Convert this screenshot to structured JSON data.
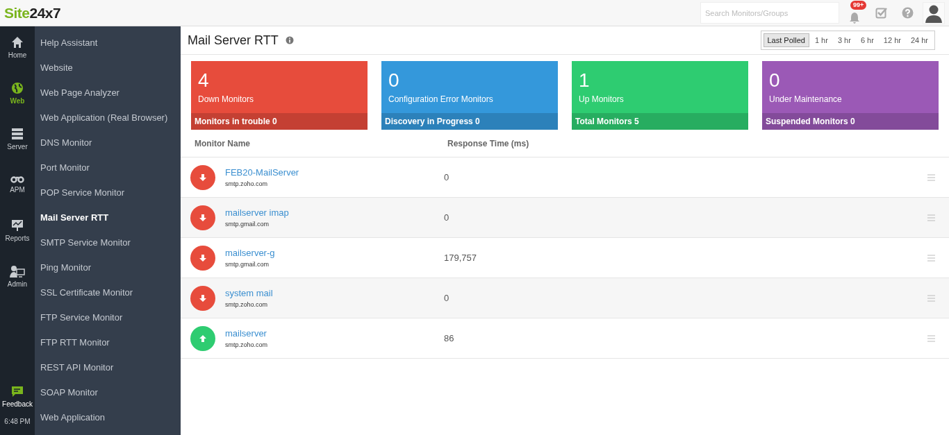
{
  "header": {
    "logo_part_1": "Site",
    "logo_part_2": "24x7",
    "search": {
      "placeholder": "Search Monitors/Groups"
    },
    "notification_badge": "99+"
  },
  "rail": {
    "items": [
      {
        "label": "Home",
        "kind": "home",
        "selected": false
      },
      {
        "label": "Web",
        "kind": "globe",
        "selected": true
      },
      {
        "label": "Server",
        "kind": "server",
        "selected": false
      },
      {
        "label": "APM",
        "kind": "binoculars",
        "selected": false
      },
      {
        "label": "Reports",
        "kind": "chart",
        "selected": false
      },
      {
        "label": "Admin",
        "kind": "admin",
        "selected": false
      }
    ],
    "feedback": "Feedback",
    "time": "6:48 PM"
  },
  "submenu": {
    "items": [
      {
        "label": "Help Assistant",
        "selected": false
      },
      {
        "label": "Website",
        "selected": false
      },
      {
        "label": "Web Page Analyzer",
        "selected": false
      },
      {
        "label": "Web Application (Real Browser)",
        "selected": false
      },
      {
        "label": "DNS Monitor",
        "selected": false
      },
      {
        "label": "Port Monitor",
        "selected": false
      },
      {
        "label": "POP Service Monitor",
        "selected": false
      },
      {
        "label": "Mail Server RTT",
        "selected": true
      },
      {
        "label": "SMTP Service Monitor",
        "selected": false
      },
      {
        "label": "Ping Monitor",
        "selected": false
      },
      {
        "label": "SSL Certificate Monitor",
        "selected": false
      },
      {
        "label": "FTP Service Monitor",
        "selected": false
      },
      {
        "label": "FTP RTT Monitor",
        "selected": false
      },
      {
        "label": "REST API Monitor",
        "selected": false
      },
      {
        "label": "SOAP Monitor",
        "selected": false
      },
      {
        "label": "Web Application",
        "selected": false
      }
    ]
  },
  "page": {
    "title": "Mail Server RTT",
    "periods": [
      {
        "label": "Last Polled",
        "selected": true
      },
      {
        "label": "1 hr",
        "selected": false
      },
      {
        "label": "3 hr",
        "selected": false
      },
      {
        "label": "6 hr",
        "selected": false
      },
      {
        "label": "12 hr",
        "selected": false
      },
      {
        "label": "24 hr",
        "selected": false
      }
    ],
    "cards": [
      {
        "count": "4",
        "label": "Down Monitors",
        "footer": "Monitors in trouble 0",
        "color": "#e74c3c"
      },
      {
        "count": "0",
        "label": "Configuration Error Monitors",
        "footer": "Discovery in Progress 0",
        "color": "#3498db"
      },
      {
        "count": "1",
        "label": "Up Monitors",
        "footer": "Total Monitors 5",
        "color": "#2ecc71"
      },
      {
        "count": "0",
        "label": "Under Maintenance",
        "footer": "Suspended Monitors 0",
        "color": "#9b59b6"
      }
    ],
    "table": {
      "columns": [
        "Monitor Name",
        "Response Time (ms)"
      ],
      "rows": [
        {
          "name": "FEB20-MailServer",
          "host": "smtp.zoho.com",
          "response": "0",
          "kind": "down"
        },
        {
          "name": "mailserver imap",
          "host": "smtp.gmail.com",
          "response": "0",
          "kind": "down"
        },
        {
          "name": "mailserver-g",
          "host": "smtp.gmail.com",
          "response": "179,757",
          "kind": "down"
        },
        {
          "name": "system mail",
          "host": "smtp.zoho.com",
          "response": "0",
          "kind": "down"
        },
        {
          "name": "mailserver",
          "host": "smtp.zoho.com",
          "response": "86",
          "kind": "up"
        }
      ]
    }
  }
}
